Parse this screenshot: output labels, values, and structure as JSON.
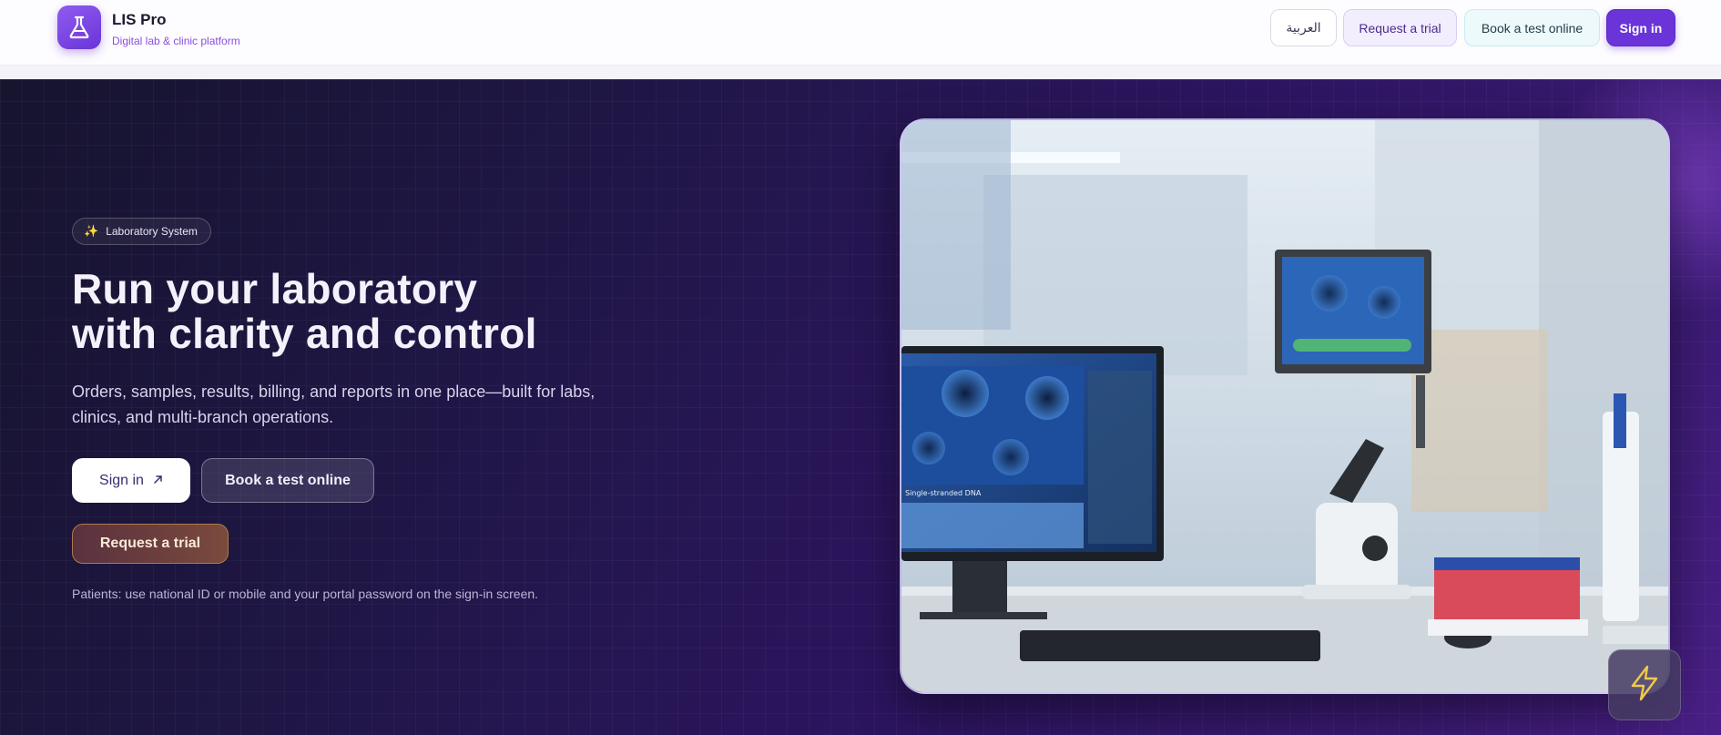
{
  "header": {
    "brand_name": "LIS Pro",
    "brand_tagline": "Digital lab & clinic platform",
    "logo_icon": "flask-icon",
    "language_label": "العربية",
    "request_trial_label": "Request a trial",
    "book_test_label": "Book a test online",
    "sign_in_label": "Sign in"
  },
  "hero": {
    "badge_icon": "sparkle-icon",
    "badge_label": "Laboratory System",
    "headline_line1": "Run your laboratory",
    "headline_line2": "with clarity and control",
    "subtext": "Orders, samples, results, billing, and reports in one place—built for labs, clinics, and multi-branch operations.",
    "sign_in_label": "Sign in",
    "sign_in_icon": "arrow-up-right-icon",
    "book_test_label": "Book a test online",
    "request_trial_label": "Request a trial",
    "patients_note": "Patients: use national ID or mobile and your portal password on the sign-in screen.",
    "flash_icon": "lightning-icon",
    "monitor_text": "Single-stranded DNA"
  },
  "colors": {
    "accent": "#6a34d8",
    "brand_tag": "#8a4fe0",
    "hero_dark": "#1f1645",
    "hero_purple": "#4a1f86",
    "trial_gold": "#b07a4a",
    "flash_yellow": "#f2c94c"
  }
}
